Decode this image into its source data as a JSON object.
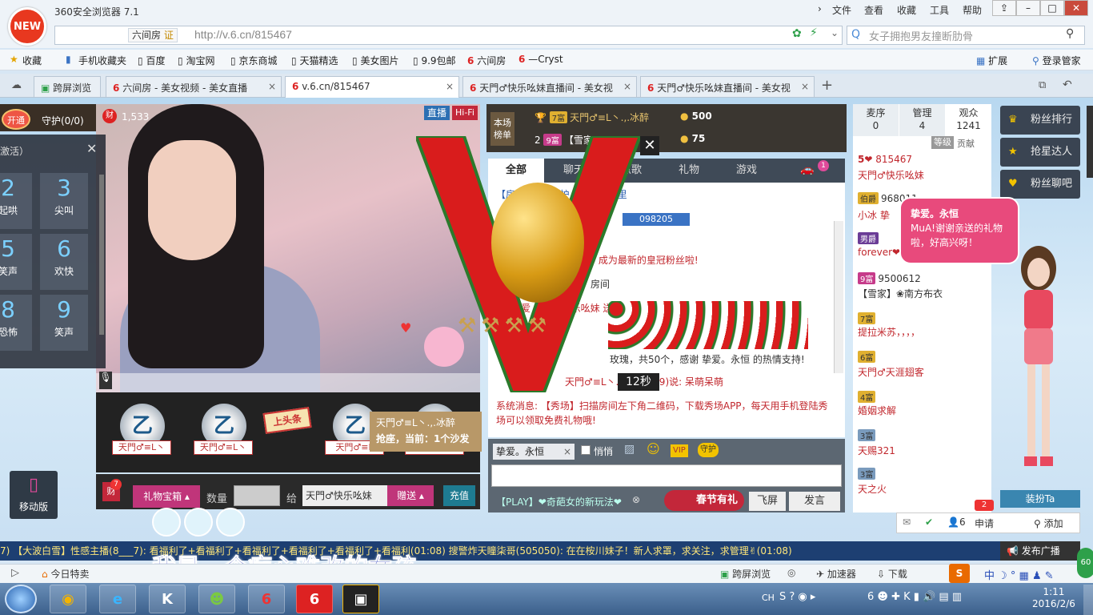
{
  "browser": {
    "logo_text": "NEW",
    "app_title": "360安全浏览器 7.1",
    "menus": [
      "文件",
      "查看",
      "收藏",
      "工具",
      "帮助"
    ],
    "site_chip": "六间房",
    "cert_chip": "证",
    "url": "http://v.6.cn/815467",
    "search_placeholder": "女子拥抱男友撞断肋骨",
    "favorites": [
      "收藏",
      "手机收藏夹",
      "百度",
      "淘宝网",
      "京东商城",
      "天猫精选",
      "美女图片",
      "9.9包邮",
      "六间房",
      "—Cryst"
    ],
    "fav_right": [
      "扩展",
      "登录管家"
    ],
    "tabs": [
      {
        "label": "跨屏浏览"
      },
      {
        "label": "六间房 - 美女视频 - 美女直播"
      },
      {
        "label": "v.6.cn/815467"
      },
      {
        "label": "天門♂快乐吆妹直播间 - 美女视"
      },
      {
        "label": "天門♂快乐吆妹直播间 - 美女视"
      }
    ],
    "new_tab": "+"
  },
  "room": {
    "open_btn": "开通",
    "guard_label": "守护(0/0)",
    "wealth_count": "1,533",
    "live_tag": "直播",
    "hifi_tag": "Hi-Fi",
    "activate_text": "激活）",
    "keys": [
      {
        "num": "2",
        "label": "起哄"
      },
      {
        "num": "3",
        "label": "尖叫"
      },
      {
        "num": "5",
        "label": "笑声"
      },
      {
        "num": "6",
        "label": "欢快"
      },
      {
        "num": "8",
        "label": "恐怖"
      },
      {
        "num": "9",
        "label": "笑声"
      }
    ],
    "gift_names": [
      "天門♂≡L丶",
      "天門♂≡L丶",
      "天門♂≡L",
      "天門♂≡L丶"
    ],
    "gift_glyph": "乙",
    "headline_badge": "上头条",
    "sofa_user": "天門♂≡L丶.,.冰醉",
    "sofa_text": "抢座，当前：1个沙发",
    "mobile_label": "移动版",
    "gift_box_label": "礼物宝箱",
    "gift_box_count": "7",
    "quantity_label": "数量",
    "to_label": "给",
    "recipient": "天門♂快乐吆妹",
    "send_btn": "赠送",
    "recharge_btn": "充值"
  },
  "ranking": {
    "label_top": "本场",
    "label_bottom": "榜单",
    "rows": [
      {
        "rank": "1",
        "level": "7富",
        "name": "天門♂≡L丶.,.冰醉",
        "value": "500"
      },
      {
        "rank": "2",
        "level": "9富",
        "name": "【雪家",
        "value": "75"
      }
    ]
  },
  "chat": {
    "tabs": [
      "全部",
      "聊天",
      "点歌",
      "礼物",
      "游戏"
    ],
    "car_badge": "1",
    "lines": [
      "【房  新人  求守护，充值点这里",
      "098205",
      "醉 成为最新的皇冠粉丝啦!",
      "房间",
      "09  挚爱  天門♂快乐吆妹 送",
      "玫瑰，共50个，感谢 挚爱。永恒 的热情支持!",
      "天門♂≡L丶.(6284799)说: 呆萌呆萌",
      "系统消息: 【秀场】扫描房间左下角二维码，下载秀场APP，每天用手机登陆秀场可以领取免费礼物哦!"
    ],
    "countdown": "12秒",
    "target_user": "挚爱。永恒",
    "whisper_label": "悄悄",
    "vip_label": "VIP",
    "guard_label": "守护",
    "spring_gift": "春节有礼",
    "fly_btn": "飞屏",
    "send_btn": "发言",
    "play_promo": "【PLAY】❤奇葩女的新玩法❤"
  },
  "users": {
    "tabs": [
      {
        "label": "麦序",
        "count": "0"
      },
      {
        "label": "管理",
        "count": "4"
      },
      {
        "label": "观众",
        "count": "1241"
      }
    ],
    "sort_level": "等级",
    "sort_contrib": "贡献",
    "items": [
      {
        "badge": "5❤",
        "id": "815467",
        "name": "天門♂快乐吆妹"
      },
      {
        "badge": "伯爵",
        "id": "968011",
        "name": "小冰 挚"
      },
      {
        "badge": "男爵",
        "id": "",
        "name": "forever❤L"
      },
      {
        "badge": "9富",
        "id": "9500612",
        "name": "【雪家】❀南方布衣"
      },
      {
        "badge": "7富",
        "id": "",
        "name": "提拉米苏，，，，"
      },
      {
        "badge": "6富",
        "id": "",
        "name": "天門♂天涯翅客"
      },
      {
        "badge": "4富",
        "id": "",
        "name": "婚姻求解"
      },
      {
        "badge": "3富",
        "id": "",
        "name": "天赐321"
      },
      {
        "badge": "3富",
        "id": "",
        "name": "天之火"
      }
    ],
    "apply_label": "申请",
    "apply_count": "2",
    "people_count": "6",
    "add_label": "添加"
  },
  "side": {
    "fans_rank": "粉丝排行",
    "star_grab": "抢星达人",
    "fans_chat": "粉丝聊吧",
    "dress_up": "装扮Ta",
    "bubble_user": "挚爱。永恒",
    "bubble_text": "MuA!谢谢亲送的礼物啦，好高兴呀！"
  },
  "ticker": {
    "text": "7)  【大波白雪】性感主播(8___7): 看福利了+看福利了+看福利了+看福利了+看福利了+看福利(01:08)    搜警炸天瞳柒哥(505050): 在在桉川妹子！新人求罩，求关注，求管理✌(01:08)",
    "broadcast_btn": "发布广播"
  },
  "subtitle": "我是一个痴心难改的女孩",
  "statusbar": {
    "today": "今日特卖",
    "right": [
      "跨屏浏览",
      "加速器",
      "下载"
    ],
    "zoom": "60"
  },
  "taskbar": {
    "time": "1:11",
    "date": "2016/2/6",
    "lang": "CH"
  }
}
